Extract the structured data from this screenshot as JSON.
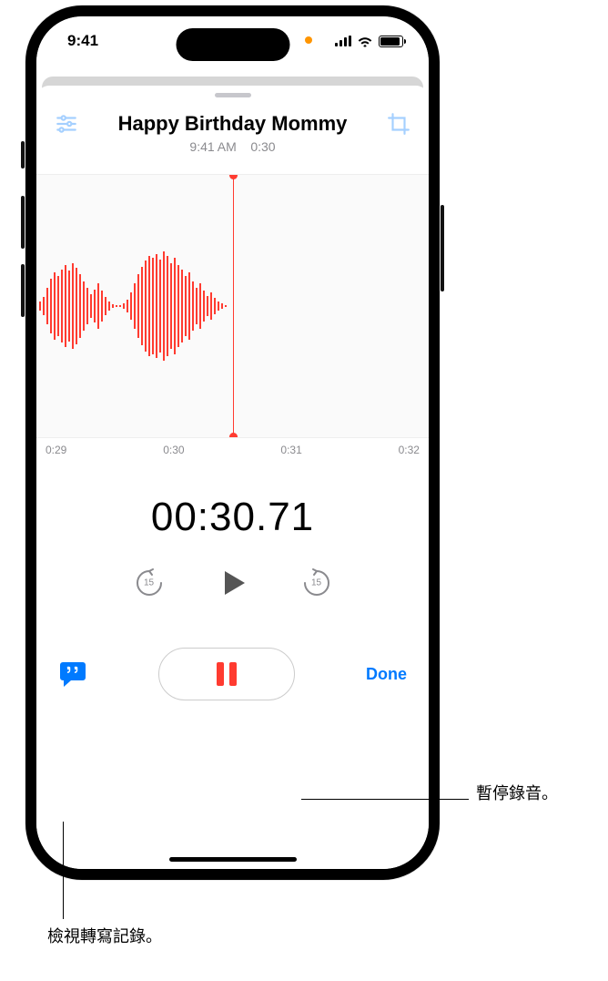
{
  "status": {
    "time": "9:41"
  },
  "recording": {
    "title": "Happy Birthday Mommy",
    "subtitle_time": "9:41 AM",
    "subtitle_duration": "0:30"
  },
  "ruler": {
    "t0": "0:29",
    "t1": "0:30",
    "t2": "0:31",
    "t3": "0:32"
  },
  "timer": "00:30.71",
  "skip": {
    "back_label": "15",
    "forward_label": "15"
  },
  "done_label": "Done",
  "callouts": {
    "pause": "暫停錄音。",
    "transcript": "檢視轉寫記錄。"
  }
}
